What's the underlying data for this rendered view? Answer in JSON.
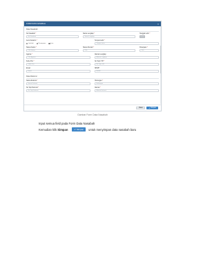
{
  "modal": {
    "title": "FORM DATA NASABAH",
    "close": "×",
    "sections": {
      "section1": "Data Nasabah",
      "section2": "Data Referral"
    },
    "fields": {
      "no_nasabah": {
        "label": "No Nasabah",
        "placeholder": "No Nasabah"
      },
      "nama": {
        "label": "Nama Lengkap",
        "placeholder": "Nama Lengkap"
      },
      "tanggal_lahir": {
        "label": "Tanggal Lahir",
        "placeholder": ""
      },
      "jenis_kelamin": {
        "label": "Jenis Kelamin",
        "options": [
          "Laki-laki",
          "Perempuan",
          "Lain"
        ]
      },
      "tempat_lahir": {
        "label": "Tempat Lahir",
        "placeholder": "Tempat Lahir"
      },
      "status_kawin": {
        "label": "Status Kawin",
        "placeholder": "Pilih Status"
      },
      "status_rumah": {
        "label": "Status Rumah",
        "placeholder": "Pilih"
      },
      "pekerjaan": {
        "label": "Pekerjaan",
        "placeholder": "Pilih"
      },
      "agama": {
        "label": "Agama",
        "placeholder": "Pilih Agama"
      },
      "alamat": {
        "label": "Alamat Lengkap",
        "placeholder": "Alamat Lengkap"
      },
      "kode_pos": {
        "label": "Kode Pos",
        "placeholder": "Kode Pos"
      },
      "no_telp": {
        "label": "No Telp / HP",
        "placeholder": "No Telp / HP"
      },
      "email": {
        "label": "Email",
        "placeholder": "Email"
      },
      "npwp": {
        "label": "NPWP",
        "placeholder": "NPWP"
      },
      "ktp": {
        "label": "No KTP",
        "placeholder": "No KTP"
      },
      "ref_nama": {
        "label": "Nama Referral",
        "placeholder": "Nama Referral"
      },
      "ref_hubungan": {
        "label": "Hubungan",
        "placeholder": "Hubungan"
      },
      "ref_telp": {
        "label": "No Telp Referral",
        "placeholder": "No Telp Referral"
      },
      "ref_alamat": {
        "label": "Alamat",
        "placeholder": "Alamat Referral"
      }
    },
    "buttons": {
      "cancel": "Batal",
      "save": "Simpan"
    }
  },
  "caption": "Gambar Form Data Nasabah",
  "instructions": {
    "line1": "Input semua field pada Form Data Nasabah",
    "line2_prefix": "Kemudian klik",
    "line2_bold": "Simpan",
    "line2_button": "Simpan",
    "line2_suffix": "untuk menyimpan data nasabah baru"
  },
  "colors": {
    "titlebar": "#2f5f8f",
    "save_button": "#3f86c8",
    "required": "#dd3333"
  }
}
